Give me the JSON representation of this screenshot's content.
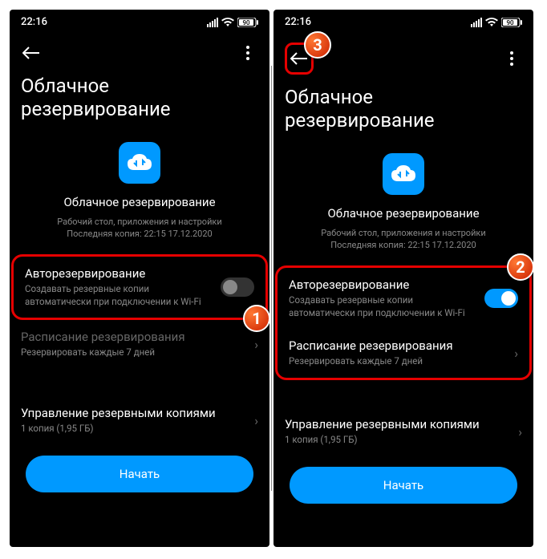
{
  "status": {
    "time": "22:16",
    "battery": "90"
  },
  "page_title": "Облачное резервирование",
  "center": {
    "title": "Облачное резервирование",
    "line1": "Рабочий стол, приложения и настройки",
    "line2": "Последняя копия: 22:15 17.12.2020"
  },
  "auto_backup": {
    "title": "Авторезервирование",
    "sub": "Создавать резервные копии автоматически при подключении к Wi-Fi"
  },
  "schedule": {
    "title": "Расписание резервирования",
    "sub": "Резервировать каждые 7 дней"
  },
  "manage": {
    "title": "Управление резервными копиями",
    "sub": "1 копия (1,95 ГБ)"
  },
  "start_label": "Начать",
  "badges": {
    "b1": "1",
    "b2": "2",
    "b3": "3"
  }
}
